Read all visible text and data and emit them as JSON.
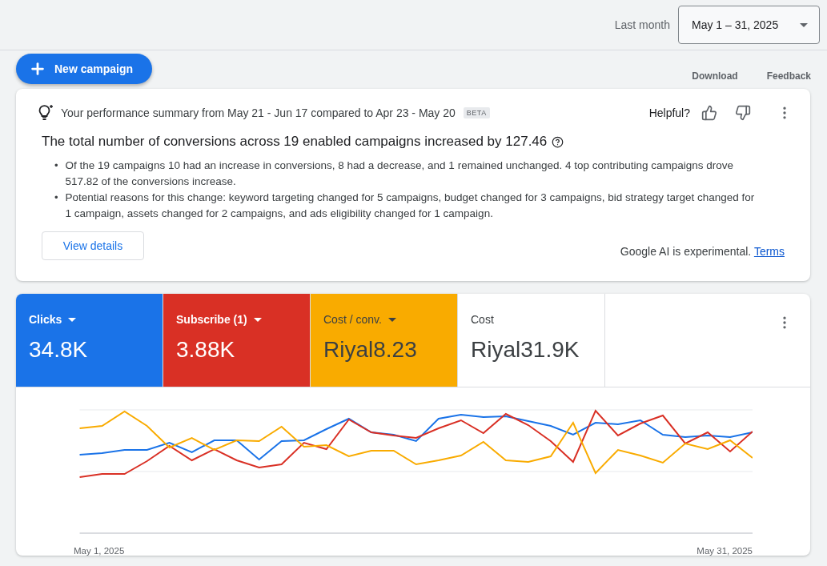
{
  "header": {
    "range_label": "Last month",
    "date_range": "May 1 – 31, 2025"
  },
  "toolbar": {
    "new_campaign": "New campaign",
    "actions": [
      "Download",
      "Feedback"
    ]
  },
  "summary": {
    "title": "Your performance summary from May 21 - Jun 17 compared to Apr 23 - May 20",
    "badge": "BETA",
    "helpful": "Helpful?",
    "headline": "The total number of conversions across 19 enabled campaigns increased by 127.46",
    "bullets": [
      {
        "marker": "•",
        "text": "Of the 19 campaigns 10 had an increase in conversions, 8 had a decrease, and 1 remained unchanged. 4 top contributing campaigns drove 517.82 of the conversions increase."
      },
      {
        "marker": "•",
        "text": "Potential reasons for this change: keyword targeting changed for 5 campaigns, budget changed for 3 campaigns, bid strategy target changed for 1 campaign, assets changed for 2 campaigns, and ads eligibility changed for 1 campaign."
      }
    ],
    "button": "View details",
    "disclaimer": "Google AI is experimental.",
    "link": "Terms"
  },
  "metrics": [
    {
      "label": "Clicks",
      "value": "34.8K",
      "selected": true,
      "dropdown": true,
      "color": "#1a73e8"
    },
    {
      "label": "Subscribe (1)",
      "value": "3.88K",
      "selected": true,
      "dropdown": true,
      "color": "#d93025"
    },
    {
      "label": "Cost / conv.",
      "value": "Riyal8.23",
      "selected": true,
      "dropdown": true,
      "color": "#f9ab00"
    },
    {
      "label": "Cost",
      "value": "Riyal31.9K",
      "selected": false,
      "dropdown": false
    }
  ],
  "chart": {
    "x_start": "May 1, 2025",
    "x_end": "May 31, 2025"
  }
}
